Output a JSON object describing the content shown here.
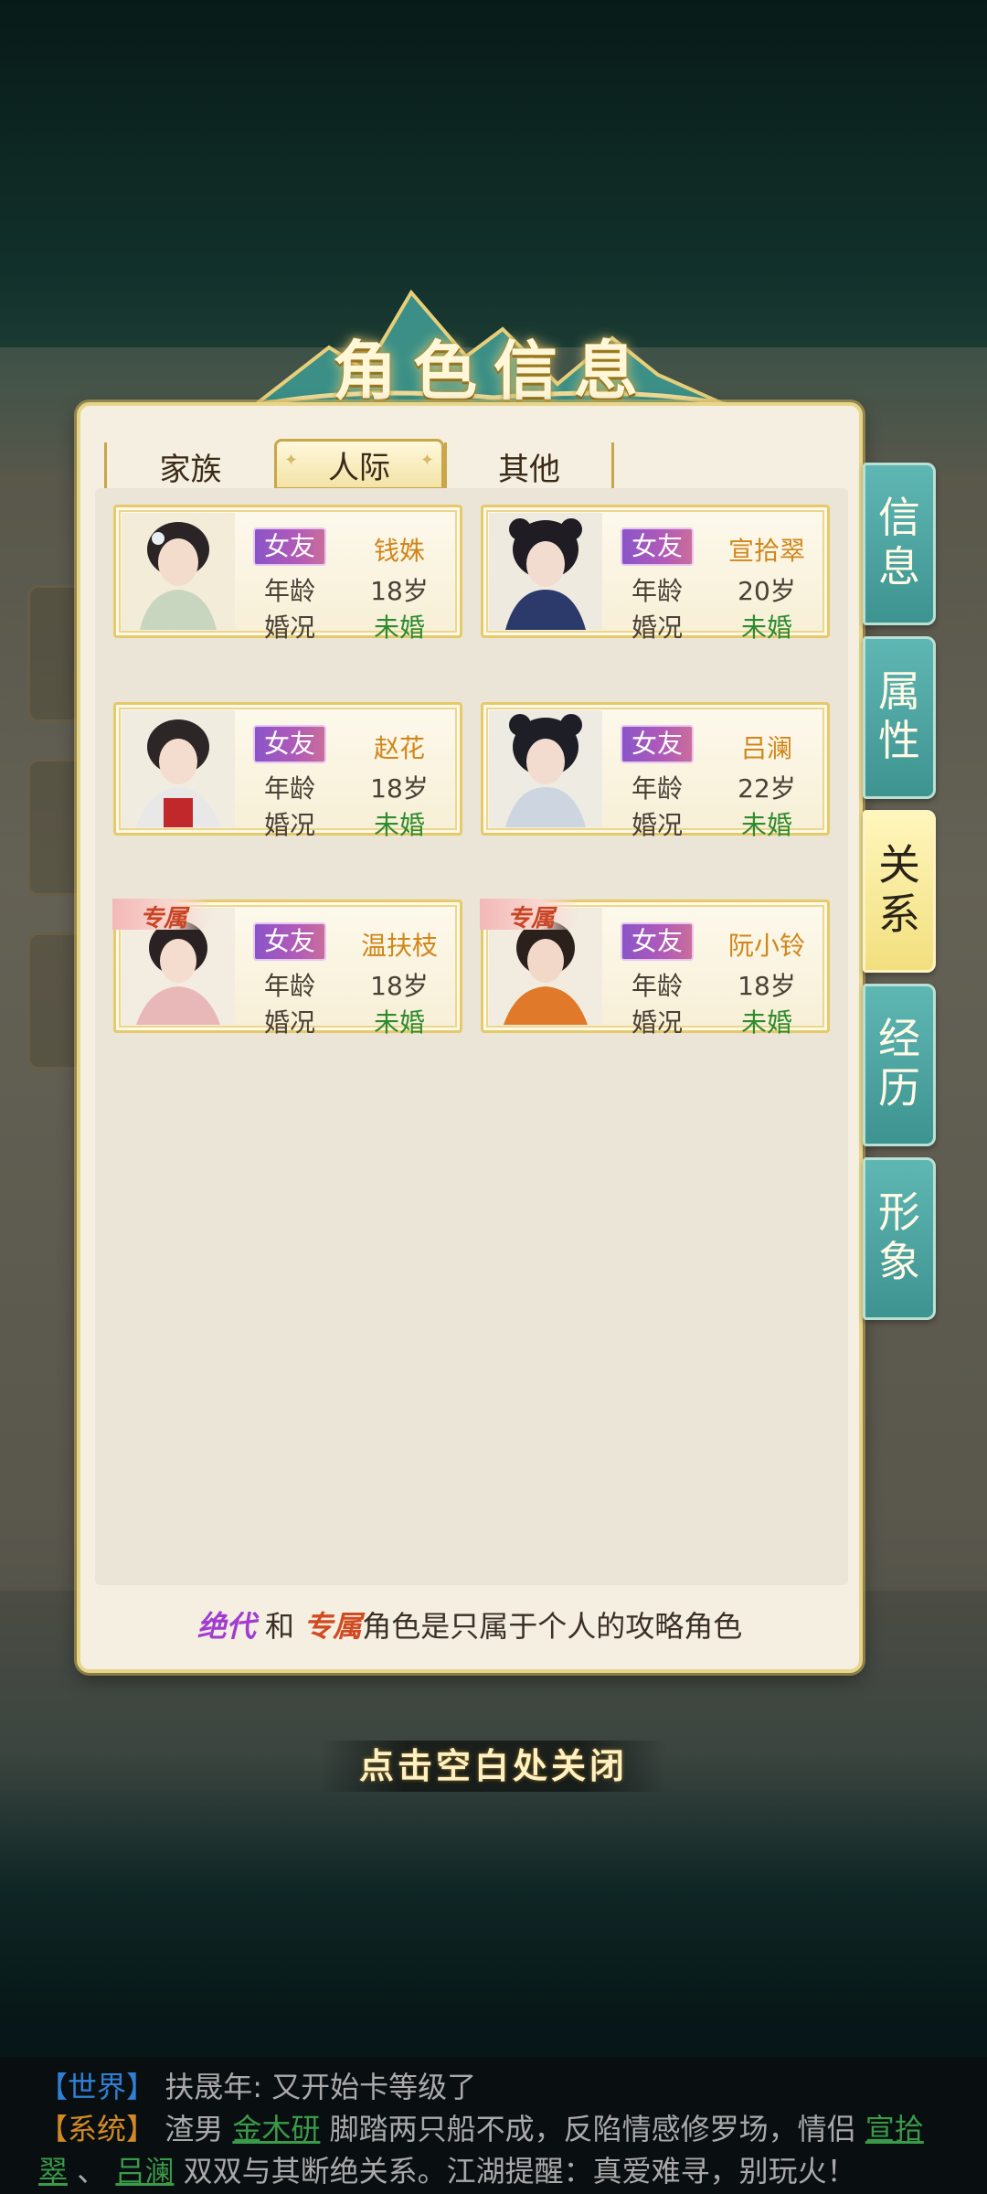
{
  "title": "角色信息",
  "tabs": [
    "家族",
    "人际",
    "其他"
  ],
  "active_tab": "人际",
  "side_tabs": [
    {
      "label": "信息",
      "active": false
    },
    {
      "label": "属性",
      "active": false
    },
    {
      "label": "关系",
      "active": true
    },
    {
      "label": "经历",
      "active": false
    },
    {
      "label": "形象",
      "active": false
    }
  ],
  "labels": {
    "age": "年龄",
    "marriage": "婚况"
  },
  "cards": [
    {
      "badge": "女友",
      "name": "钱姝",
      "age": "18岁",
      "marriage": "未婚",
      "exclusive": false
    },
    {
      "badge": "女友",
      "name": "宣拾翠",
      "age": "20岁",
      "marriage": "未婚",
      "exclusive": false
    },
    {
      "badge": "女友",
      "name": "赵花",
      "age": "18岁",
      "marriage": "未婚",
      "exclusive": false
    },
    {
      "badge": "女友",
      "name": "吕澜",
      "age": "22岁",
      "marriage": "未婚",
      "exclusive": false
    },
    {
      "badge": "女友",
      "name": "温扶枝",
      "age": "18岁",
      "marriage": "未婚",
      "exclusive": true
    },
    {
      "badge": "女友",
      "name": "阮小铃",
      "age": "18岁",
      "marriage": "未婚",
      "exclusive": true
    }
  ],
  "exclusive_tag": "专属",
  "footnote": {
    "a": "绝代",
    "and": " 和 ",
    "b": "专属",
    "rest": "角色是只属于个人的攻略角色"
  },
  "close_hint": "点击空白处关闭",
  "chat": {
    "line1_channel": "【世界】",
    "line1_text": " 扶晟年: 又开始卡等级了",
    "line2_channel": "【系统】",
    "line2_pre": " 渣男 ",
    "line2_link1": "金木研",
    "line2_mid": " 脚踏两只船不成，反陷情感修罗场，情侣 ",
    "line2_link2": "宣拾翠",
    "line2_sep": " 、 ",
    "line2_link3": "吕澜",
    "line2_post": " 双双与其断绝关系。江湖提醒：真爱难寻，别玩火！"
  },
  "colors": {
    "accent_gold": "#e6c96a",
    "badge_purple": "#8a55c8",
    "side_teal": "#3d938f",
    "name_orange": "#d0861a",
    "status_green": "#2e8b2e"
  }
}
